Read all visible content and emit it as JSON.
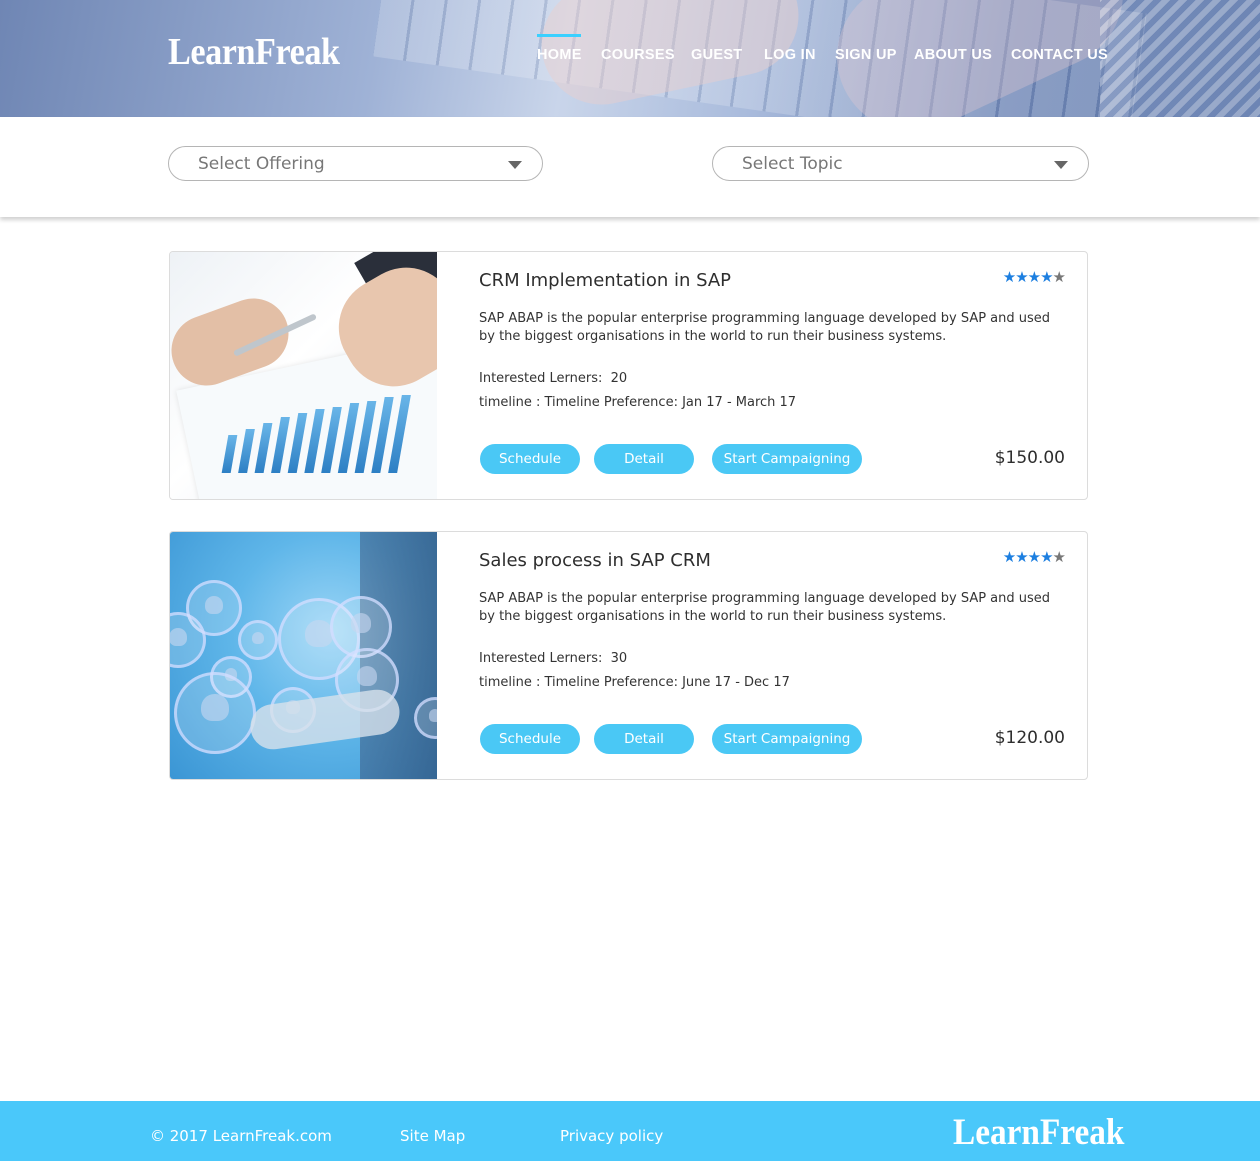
{
  "brand": {
    "name": "LearnFreak"
  },
  "nav": {
    "items": [
      "HOME",
      "COURSES",
      "GUEST",
      "LOG IN",
      "SIGN UP",
      "ABOUT US",
      "CONTACT US"
    ],
    "active": "HOME"
  },
  "filters": {
    "offering": {
      "value": "Select Offering"
    },
    "topic": {
      "value": "Select Topic"
    }
  },
  "courses": [
    {
      "title": "CRM Implementation in SAP",
      "rating": 4,
      "rating_max": 5,
      "description": "SAP ABAP is the popular enterprise programming language developed by SAP and used by the biggest organisations in the world to run their business systems.",
      "learners_label": "Interested Lerners:",
      "learners": "20",
      "timeline_label": "timeline : Timeline Preference:",
      "timeline": "Jan 17 - March 17",
      "schedule_label": "Schedule",
      "detail_label": "Detail",
      "campaign_label": "Start Campaigning",
      "price": "$150.00"
    },
    {
      "title": "Sales process in SAP CRM",
      "rating": 4,
      "rating_max": 5,
      "description": "SAP ABAP is the popular enterprise programming language developed by SAP and used by the biggest organisations in the world to run their business systems.",
      "learners_label": "Interested Lerners:",
      "learners": "30",
      "timeline_label": "timeline : Timeline Preference:",
      "timeline": "June 17 - Dec 17",
      "schedule_label": "Schedule",
      "detail_label": "Detail",
      "campaign_label": "Start Campaigning",
      "price": "$120.00"
    }
  ],
  "footer": {
    "copyright": "© 2017 LearnFreak.com",
    "sitemap": "Site Map",
    "privacy": "Privacy policy",
    "logo": "LearnFreak"
  },
  "colors": {
    "accent": "#4ac8f5",
    "footer_bg": "#4ac8fa",
    "star_on": "#1d7fe0",
    "nav_active_bar": "#3ad0ff"
  }
}
